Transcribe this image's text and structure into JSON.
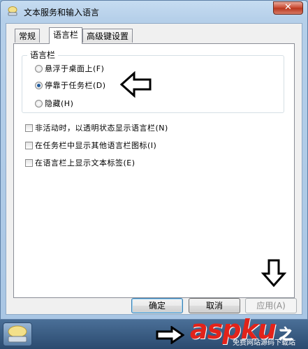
{
  "window": {
    "title": "文本服务和输入语言",
    "close_label": "✕"
  },
  "tabs": [
    {
      "label": "常规",
      "active": false
    },
    {
      "label": "语言栏",
      "active": true
    },
    {
      "label": "高级键设置",
      "active": false
    }
  ],
  "language_bar": {
    "group_title": "语言栏",
    "options": [
      {
        "label": "悬浮于桌面上(F)",
        "selected": false
      },
      {
        "label": "停靠于任务栏(D)",
        "selected": true
      },
      {
        "label": "隐藏(H)",
        "selected": false
      }
    ]
  },
  "checkboxes": [
    {
      "label": "非活动时，以透明状态显示语言栏(N)",
      "checked": false
    },
    {
      "label": "在任务栏中显示其他语言栏图标(I)",
      "checked": false
    },
    {
      "label": "在语言栏上显示文本标签(E)",
      "checked": false
    }
  ],
  "buttons": {
    "ok": "确定",
    "cancel": "取消",
    "apply": "应用(A)"
  },
  "watermark": {
    "brand": "aspku",
    "tagline": "免费网站源码下载站",
    "suffix": "之"
  },
  "colors": {
    "accent": "#215c9e",
    "close": "#c7452c",
    "watermark": "#e2231a"
  },
  "icons": [
    "keyboard-language-icon",
    "close-icon",
    "arrow-left-icon",
    "arrow-down-icon",
    "arrow-right-icon"
  ]
}
